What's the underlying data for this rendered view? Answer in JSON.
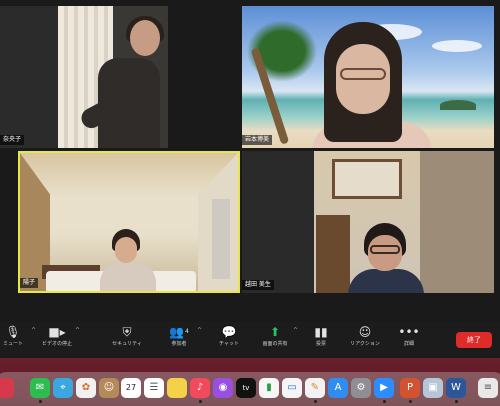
{
  "participants": [
    {
      "name": "奈央子"
    },
    {
      "name": "岩本博美"
    },
    {
      "name": "陽子"
    },
    {
      "name": "越田 美生"
    }
  ],
  "toolbar": {
    "items": [
      {
        "label": "ミュート",
        "icon": "microphone-icon"
      },
      {
        "label": "ビデオの停止",
        "icon": "video-camera-icon"
      },
      {
        "label": "セキュリティ",
        "icon": "shield-icon"
      },
      {
        "label": "参加者",
        "icon": "participants-icon",
        "count": "4"
      },
      {
        "label": "チャット",
        "icon": "chat-icon"
      },
      {
        "label": "画面の共有",
        "icon": "share-screen-icon"
      },
      {
        "label": "投票",
        "icon": "poll-icon"
      },
      {
        "label": "リアクション",
        "icon": "reaction-icon"
      },
      {
        "label": "詳細",
        "icon": "more-icon"
      }
    ],
    "end_label": "終了"
  },
  "dock": {
    "calendar_day": "27"
  },
  "colors": {
    "active_speaker_border": "#e6e74b",
    "end_button": "#e02b2b",
    "share_icon": "#22c55e"
  }
}
